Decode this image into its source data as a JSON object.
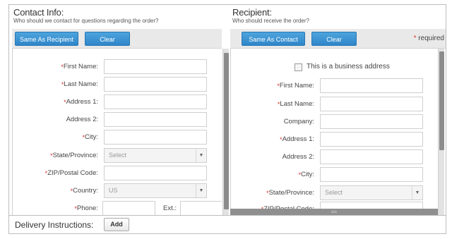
{
  "contact": {
    "title": "Contact Info:",
    "subtitle": "Who should we contact for questions regarding the order?",
    "same_as_label": "Same As Recipient",
    "clear_label": "Clear",
    "fields": {
      "first_name": "First Name:",
      "last_name": "Last Name:",
      "address1": "Address 1:",
      "address2": "Address 2:",
      "city": "City:",
      "state": "State/Province:",
      "state_value": "Select",
      "zip": "ZIP/Postal Code:",
      "country": "Country:",
      "country_value": "US",
      "phone": "Phone:",
      "ext": "Ext.:"
    }
  },
  "recipient": {
    "title": "Recipient:",
    "subtitle": "Who should receive the order?",
    "same_as_label": "Same As Contact",
    "clear_label": "Clear",
    "required_label": "required",
    "business_label": "This is a business address",
    "fields": {
      "first_name": "First Name:",
      "last_name": "Last Name:",
      "company": "Company:",
      "address1": "Address 1:",
      "address2": "Address 2:",
      "city": "City:",
      "state": "State/Province:",
      "state_value": "Select",
      "zip": "ZIP/Postal Code:"
    }
  },
  "footer": {
    "delivery_label": "Delivery Instructions:",
    "add_label": "Add"
  },
  "star": "*",
  "colors": {
    "button_blue": "#2f86c9",
    "required_star": "#d9342b"
  }
}
